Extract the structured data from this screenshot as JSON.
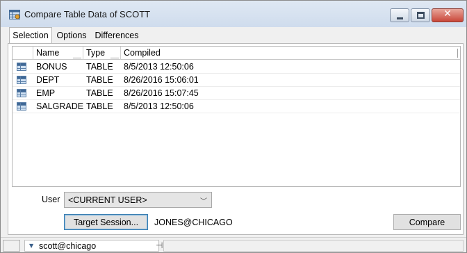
{
  "window": {
    "title": "Compare Table Data of SCOTT",
    "icons": {
      "app": "table-compare-icon",
      "minimize": "minimize-icon",
      "maximize": "maximize-icon",
      "close": "close-icon"
    },
    "close_glyph": "✕"
  },
  "tabs": [
    {
      "label": "Selection",
      "active": true
    },
    {
      "label": "Options",
      "active": false
    },
    {
      "label": "Differences",
      "active": false
    }
  ],
  "table": {
    "columns": [
      "",
      "Name",
      "Type",
      "Compiled"
    ],
    "row_icon": "table-icon",
    "rows": [
      {
        "name": "BONUS",
        "type": "TABLE",
        "compiled": "8/5/2013 12:50:06"
      },
      {
        "name": "DEPT",
        "type": "TABLE",
        "compiled": "8/26/2016 15:06:01"
      },
      {
        "name": "EMP",
        "type": "TABLE",
        "compiled": "8/26/2016 15:07:45"
      },
      {
        "name": "SALGRADE",
        "type": "TABLE",
        "compiled": "8/5/2013 12:50:06"
      }
    ]
  },
  "user": {
    "label": "User",
    "selected": "<CURRENT USER>",
    "chevron": "﹀"
  },
  "target_session": {
    "button_label": "Target Session...",
    "value": "JONES@CHICAGO"
  },
  "compare_button": "Compare",
  "statusbar": {
    "connection": "scott@chicago",
    "arrow": "▼",
    "pin": "⊣"
  },
  "colors": {
    "accent": "#3c7fb1",
    "close_button": "#c9473a"
  }
}
